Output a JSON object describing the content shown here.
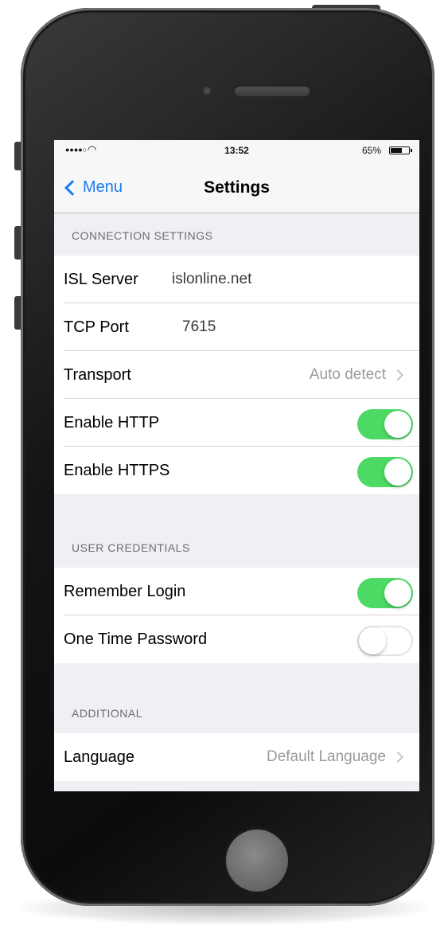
{
  "status_bar": {
    "signal": "●●●●○",
    "wifi_icon": "wifi-icon",
    "time": "13:52",
    "battery_percent": "65%",
    "battery_level": 0.65
  },
  "nav": {
    "back_label": "Menu",
    "title": "Settings"
  },
  "sections": {
    "connection": {
      "header": "CONNECTION SETTINGS",
      "isl_server_label": "ISL Server",
      "isl_server_value": "islonline.net",
      "tcp_port_label": "TCP Port",
      "tcp_port_value": "7615",
      "transport_label": "Transport",
      "transport_value": "Auto detect",
      "enable_http_label": "Enable HTTP",
      "enable_http_on": true,
      "enable_https_label": "Enable HTTPS",
      "enable_https_on": true
    },
    "credentials": {
      "header": "USER CREDENTIALS",
      "remember_login_label": "Remember Login",
      "remember_login_on": true,
      "otp_label": "One Time Password",
      "otp_on": false
    },
    "additional": {
      "header": "ADDITIONAL",
      "language_label": "Language",
      "language_value": "Default Language"
    }
  },
  "colors": {
    "accent": "#1b7cf4",
    "switch_on": "#4cd964",
    "background": "#efeff4"
  }
}
